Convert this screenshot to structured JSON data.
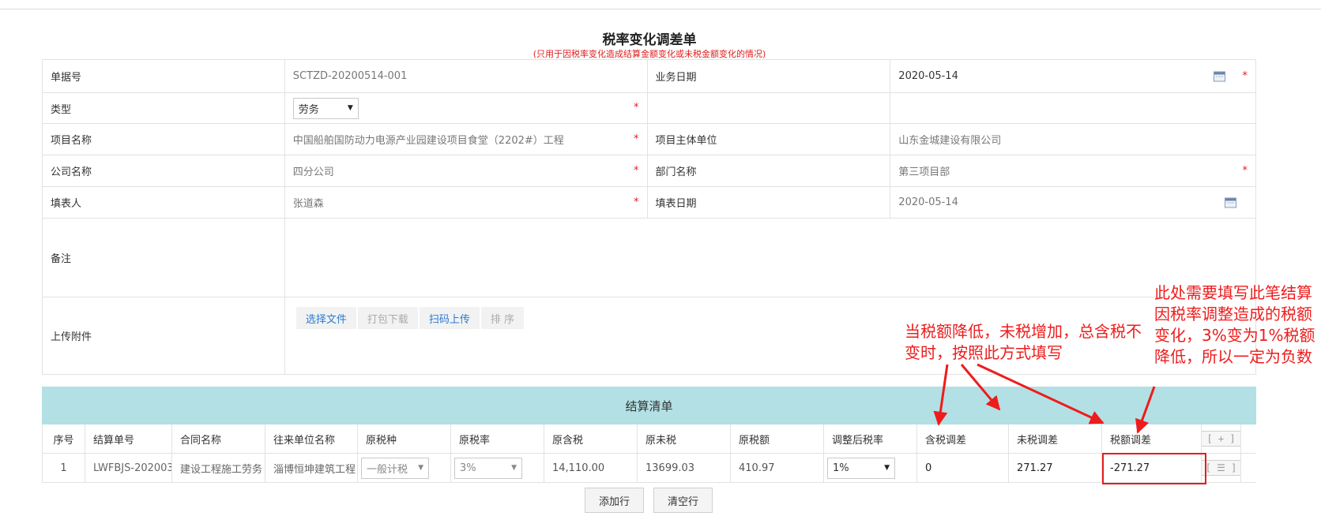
{
  "title": "税率变化调差单",
  "subtitle": "(只用于因税率变化造成结算金额变化或未税金额变化的情况)",
  "form": {
    "doc_no_label": "单据号",
    "doc_no_value": "SCTZD-20200514-001",
    "biz_date_label": "业务日期",
    "biz_date_value": "2020-05-14",
    "type_label": "类型",
    "type_value": "劳务",
    "project_label": "项目名称",
    "project_value": "中国船舶国防动力电源产业园建设项目食堂（2202#）工程",
    "project_owner_label": "项目主体单位",
    "project_owner_value": "山东金城建设有限公司",
    "company_label": "公司名称",
    "company_value": "四分公司",
    "dept_label": "部门名称",
    "dept_value": "第三项目部",
    "filler_label": "填表人",
    "filler_value": "张道森",
    "fill_date_label": "填表日期",
    "fill_date_value": "2020-05-14",
    "remark_label": "备注",
    "attach_label": "上传附件",
    "attach_buttons": {
      "choose": "选择文件",
      "pack": "打包下载",
      "scan": "扫码上传",
      "sort": "排 序"
    },
    "required_mark": "*"
  },
  "settlement": {
    "section_title": "结算清单",
    "headers": [
      "序号",
      "结算单号",
      "合同名称",
      "往来单位名称",
      "原税种",
      "原税率",
      "原含税",
      "原未税",
      "原税额",
      "调整后税率",
      "含税调差",
      "未税调差",
      "税额调差"
    ],
    "add_col_btn": "[ + ]",
    "row": {
      "index": "1",
      "settle_no": "LWFBJS-202003",
      "contract": "建设工程施工劳务",
      "partner": "淄博恒坤建筑工程",
      "tax_type": "一般计税",
      "orig_rate": "3%",
      "orig_incl": "14,110.00",
      "orig_excl": "13699.03",
      "orig_tax": "410.97",
      "new_rate": "1%",
      "diff_incl": "0",
      "diff_excl": "271.27",
      "diff_tax": "-271.27",
      "row_menu_btn": "[ ☰ ]"
    },
    "add_row": "添加行",
    "clear_rows": "清空行"
  },
  "annotations": {
    "note1": "当税额降低，未税增加，总含税不变时，按照此方式填写",
    "note2": "此处需要填写此笔结算因税率调整造成的税额变化，3%变为1%税额降低，所以一定为负数",
    "color": "#ee1c1c"
  }
}
